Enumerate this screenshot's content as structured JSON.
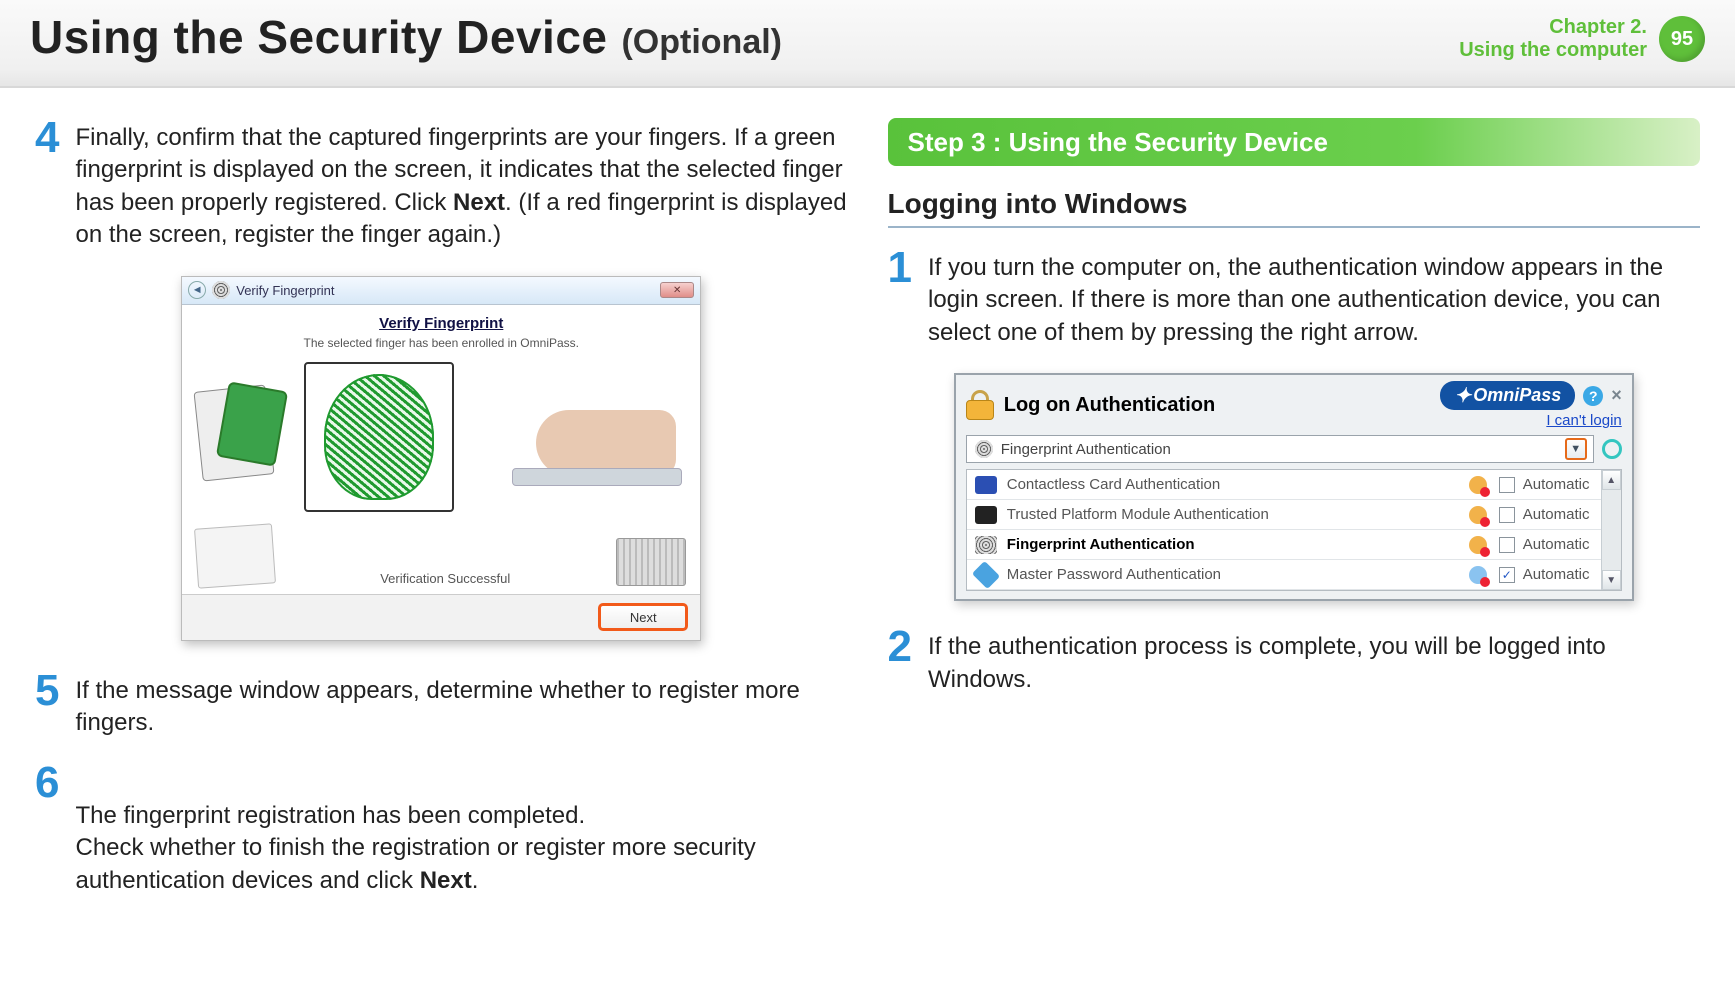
{
  "header": {
    "title": "Using the Security Device",
    "optional": "(Optional)",
    "chapter_line1": "Chapter 2.",
    "chapter_line2": "Using the computer",
    "page_number": "95"
  },
  "left": {
    "step4": {
      "num": "4",
      "text_a": "Finally, confirm that the captured fingerprints are your fingers. If a green fingerprint is displayed on the screen, it indicates that the selected finger has been properly registered. Click ",
      "text_bold": "Next",
      "text_b": ". (If a red fingerprint is displayed on the screen, register the finger again.)"
    },
    "fig1": {
      "window_title": "Verify Fingerprint",
      "heading": "Verify Fingerprint",
      "subtext": "The selected finger has been enrolled in OmniPass.",
      "status": "Verification Successful",
      "next_button": "Next"
    },
    "step5": {
      "num": "5",
      "text": "If the message window appears, determine whether to register more fingers."
    },
    "step6": {
      "num": "6",
      "text_a": "The fingerprint registration has been completed.\nCheck whether to finish the registration or register more security authentication devices and click ",
      "text_bold": "Next",
      "text_b": "."
    }
  },
  "right": {
    "banner": "Step 3 : Using the Security Device",
    "subhead": "Logging into Windows",
    "step1": {
      "num": "1",
      "text": "If you turn the computer on, the authentication window appears in the login screen. If there is more than one authentication device, you can select one of them by pressing the right arrow."
    },
    "fig2": {
      "title": "Log on Authentication",
      "brand": "OmniPass",
      "help": "?",
      "close": "×",
      "cant_login": "I can't login",
      "selected": "Fingerprint Authentication",
      "rows": [
        {
          "label": "Contactless Card Authentication",
          "auto": "Automatic",
          "checked": false,
          "selected": false
        },
        {
          "label": "Trusted Platform Module Authentication",
          "auto": "Automatic",
          "checked": false,
          "selected": false
        },
        {
          "label": "Fingerprint Authentication",
          "auto": "Automatic",
          "checked": false,
          "selected": true
        },
        {
          "label": "Master Password Authentication",
          "auto": "Automatic",
          "checked": true,
          "selected": false
        }
      ]
    },
    "step2": {
      "num": "2",
      "text": "If the authentication process is complete, you will be logged into Windows."
    }
  }
}
